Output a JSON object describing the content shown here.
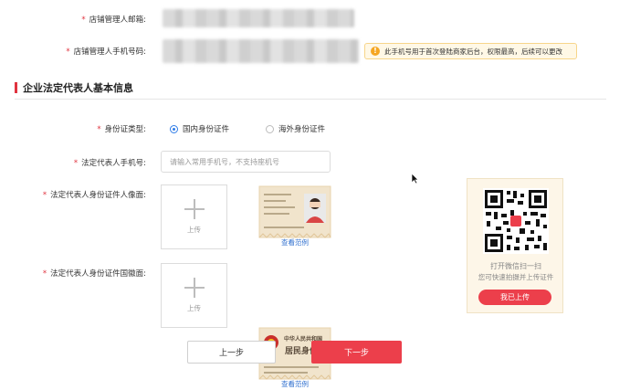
{
  "store_manager": {
    "email_label": "店铺管理人邮箱:",
    "phone_label": "店铺管理人手机号码:",
    "phone_tip": "此手机号用于首次登陆商家后台，权限最高，后续可以更改"
  },
  "section": {
    "title": "企业法定代表人基本信息"
  },
  "id_type": {
    "label": "身份证类型:",
    "options": [
      "国内身份证件",
      "海外身份证件"
    ],
    "selected": "国内身份证件"
  },
  "legal_phone": {
    "label": "法定代表人手机号:",
    "placeholder": "请输入常用手机号，不支持座机号"
  },
  "id_front": {
    "label": "法定代表人身份证件人像面:",
    "upload_text": "上传",
    "sample_link": "查看范例"
  },
  "id_back": {
    "label": "法定代表人身份证件国徽面:",
    "upload_text": "上传",
    "sample_link": "查看范例",
    "sample_title": "中华人民共和国",
    "sample_subtitle": "居民身份证"
  },
  "qr": {
    "line1": "打开微信扫一扫",
    "line2": "您可快速拍摄并上传证件",
    "button": "我已上传"
  },
  "nav": {
    "prev": "上一步",
    "next": "下一步"
  },
  "colors": {
    "accent": "#ec3f4b",
    "radio": "#2f7ce8",
    "tip_bg": "#fff8e6",
    "tip_icon": "#f5a623"
  }
}
